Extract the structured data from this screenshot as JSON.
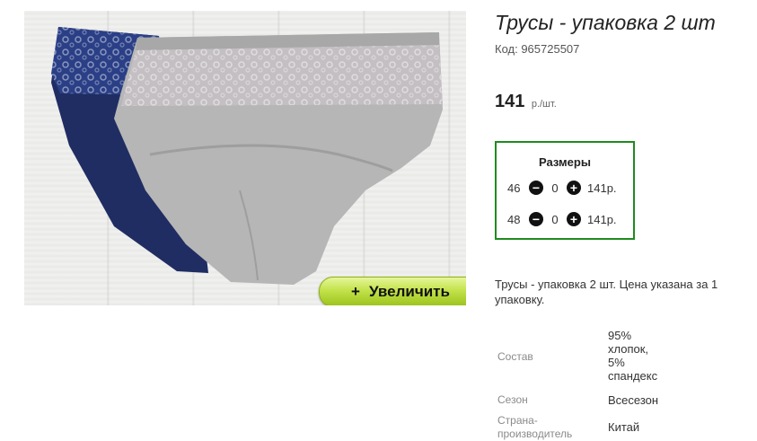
{
  "product": {
    "title": "Трусы - упаковка 2 шт",
    "code": "Код: 965725507",
    "price": "141",
    "price_unit": "р./шт.",
    "zoom_label": "Увеличить",
    "zoom_icon": "plus-icon"
  },
  "sizes": {
    "title": "Размеры",
    "rows": [
      {
        "size": "46",
        "qty": "0",
        "price": "141р."
      },
      {
        "size": "48",
        "qty": "0",
        "price": "141р."
      }
    ]
  },
  "description": "Трусы - упаковка 2 шт. Цена указана за 1 упаковку.",
  "attributes": [
    {
      "label": "Состав",
      "value_lines": [
        "95%",
        "хлопок,",
        "5%",
        "спандекс"
      ]
    },
    {
      "label": "Сезон",
      "value_lines": [
        "Всесезон"
      ]
    },
    {
      "label_lines": [
        "Страна-",
        "производитель"
      ],
      "value_lines": [
        "Китай"
      ]
    }
  ],
  "colors": {
    "accent_green": "#1f8b1f",
    "button_green": "#9cc21c",
    "navy": "#1f2d63",
    "gray": "#b4b4b4"
  }
}
